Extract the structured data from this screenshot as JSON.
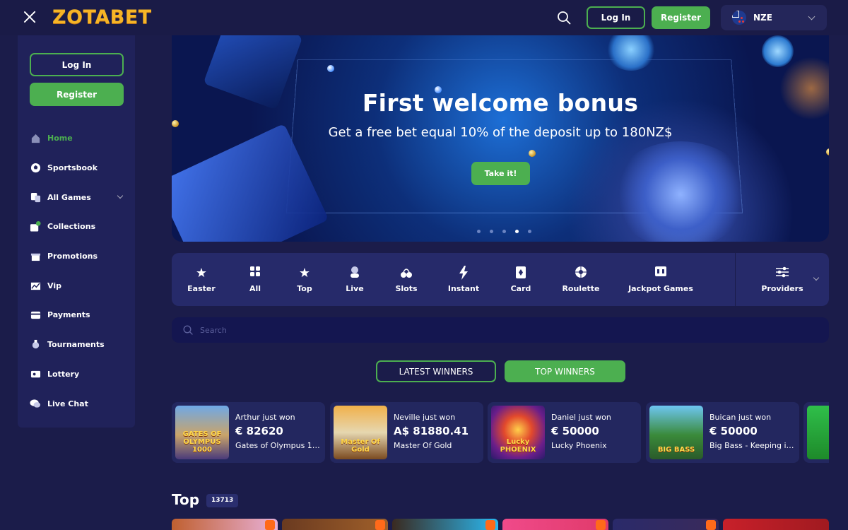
{
  "header": {
    "logo": "ZOTABET",
    "login_label": "Log In",
    "register_label": "Register",
    "currency_code": "NZE"
  },
  "sidebar": {
    "login_label": "Log In",
    "register_label": "Register",
    "items": [
      {
        "label": "Home",
        "icon": "home-icon",
        "active": true
      },
      {
        "label": "Sportsbook",
        "icon": "football-icon"
      },
      {
        "label": "All Games",
        "icon": "games-icon",
        "has_chevron": true
      },
      {
        "label": "Collections",
        "icon": "collections-icon"
      },
      {
        "label": "Promotions",
        "icon": "gift-icon"
      },
      {
        "label": "Vip",
        "icon": "vip-icon"
      },
      {
        "label": "Payments",
        "icon": "wallet-icon"
      },
      {
        "label": "Tournaments",
        "icon": "trophy-icon"
      },
      {
        "label": "Lottery",
        "icon": "lottery-icon"
      },
      {
        "label": "Live Chat",
        "icon": "chat-icon"
      }
    ]
  },
  "banner": {
    "title": "First welcome bonus",
    "subtitle": "Get a free bet equal 10% of the deposit up to 180NZ$",
    "cta_label": "Take it!",
    "slides_total": 5,
    "active_slide": 4
  },
  "categories": [
    {
      "label": "Easter",
      "icon": "star-icon"
    },
    {
      "label": "All",
      "icon": "grid-icon"
    },
    {
      "label": "Top",
      "icon": "star-icon"
    },
    {
      "label": "Live",
      "icon": "dealer-icon"
    },
    {
      "label": "Slots",
      "icon": "cherry-icon"
    },
    {
      "label": "Instant",
      "icon": "lightning-icon"
    },
    {
      "label": "Card",
      "icon": "card-icon"
    },
    {
      "label": "Roulette",
      "icon": "roulette-icon"
    },
    {
      "label": "Jackpot Games",
      "icon": "jackpot-icon"
    },
    {
      "label": "Providers",
      "icon": "sliders-icon"
    }
  ],
  "search": {
    "placeholder": "Search"
  },
  "winner_tabs": {
    "latest": "LATEST WINNERS",
    "top": "TOP WINNERS",
    "active": "top"
  },
  "winners": [
    {
      "who": "Arthur just won",
      "amount": "€ 82620",
      "game": "Gates of Olympus 1000",
      "thumb_text": "GATES OF OLYMPUS 1000"
    },
    {
      "who": "Neville just won",
      "amount": "A$ 81880.41",
      "game": "Master Of Gold",
      "thumb_text": "Master Of Gold"
    },
    {
      "who": "Daniel just won",
      "amount": "€ 50000",
      "game": "Lucky Phoenix",
      "thumb_text": "Lucky PHOENIX"
    },
    {
      "who": "Buican just won",
      "amount": "€ 50000",
      "game": "Big Bass - Keeping it Reel",
      "thumb_text": "BIG BASS"
    }
  ],
  "top_section": {
    "title": "Top",
    "count": "13713"
  },
  "colors": {
    "accent_green": "#4caf50",
    "logo_gold": "#f6b526",
    "background": "#1b1c4a"
  }
}
